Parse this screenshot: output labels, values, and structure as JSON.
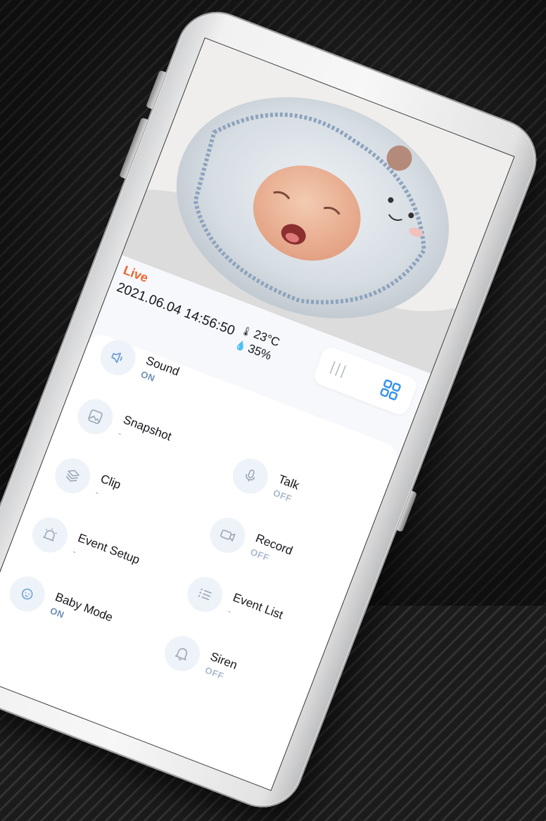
{
  "camera": {
    "live_label": "Live",
    "timestamp": "2021.06.04 14:56:50",
    "temperature": "23°C",
    "humidity": "35%",
    "temp_icon": "thermometer-icon",
    "humidity_icon": "droplet-icon"
  },
  "view_toggle": {
    "options": [
      "list-view-icon",
      "grid-view-icon"
    ],
    "selected": "grid-view-icon",
    "list_glyph": "|||",
    "accent": "#2f8ff0"
  },
  "controls": {
    "sound": {
      "label": "Sound",
      "state": "ON",
      "icon": "speaker-icon"
    },
    "snapshot": {
      "label": "Snapshot",
      "state": "-",
      "icon": "image-icon"
    },
    "talk": {
      "label": "Talk",
      "state": "OFF",
      "icon": "microphone-icon"
    },
    "clip": {
      "label": "Clip",
      "state": "-",
      "icon": "layers-icon"
    },
    "record": {
      "label": "Record",
      "state": "OFF",
      "icon": "video-camera-icon"
    },
    "event_setup": {
      "label": "Event Setup",
      "state": "-",
      "icon": "alarm-light-icon"
    },
    "event_list": {
      "label": "Event List",
      "state": "-",
      "icon": "list-icon"
    },
    "baby_mode": {
      "label": "Baby Mode",
      "state": "ON",
      "icon": "baby-icon"
    },
    "siren": {
      "label": "Siren",
      "state": "OFF",
      "icon": "bell-icon"
    }
  },
  "colors": {
    "live": "#f0642f",
    "state_on": "#6d8fb8",
    "state_off": "#a9b9cc",
    "icon_circle": "#eef3f9"
  }
}
